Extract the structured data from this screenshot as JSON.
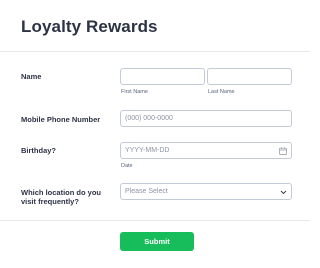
{
  "form": {
    "title": "Loyalty Rewards",
    "fields": {
      "name": {
        "label": "Name",
        "first_sublabel": "First Name",
        "last_sublabel": "Last Name",
        "first_value": "",
        "last_value": ""
      },
      "phone": {
        "label": "Mobile Phone Number",
        "placeholder": "(000) 000-0000"
      },
      "birthday": {
        "label": "Birthday?",
        "placeholder": "YYYY-MM-DD",
        "sublabel": "Date",
        "icon": "calendar-icon"
      },
      "location": {
        "label": "Which location do you visit frequently?",
        "selected": "Please Select",
        "icon": "chevron-down-icon"
      }
    },
    "submit_label": "Submit"
  },
  "colors": {
    "accent": "#18bd5b",
    "text": "#2c3345",
    "border": "#c3cad8",
    "placeholder": "#8d93a3"
  }
}
